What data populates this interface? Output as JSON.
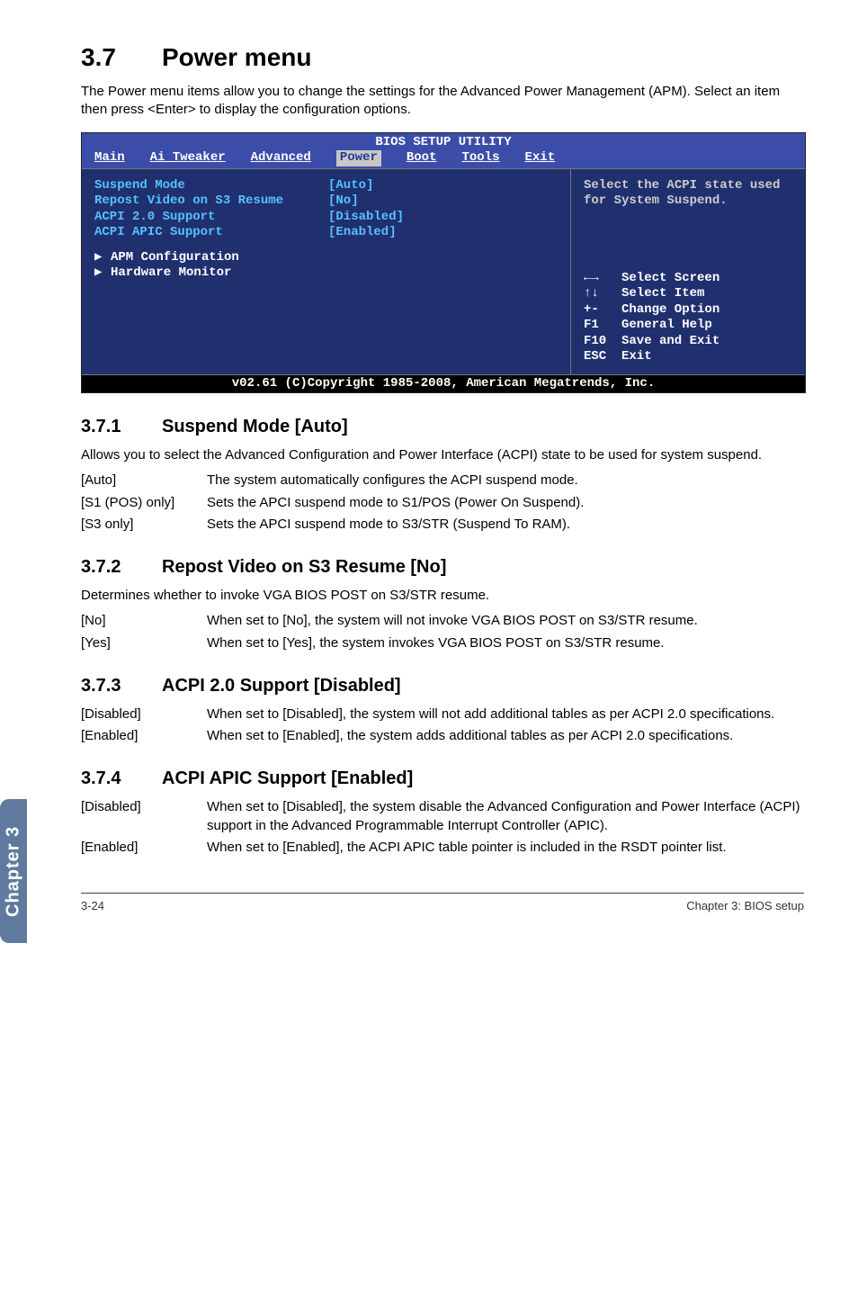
{
  "heading": {
    "num": "3.7",
    "title": "Power menu"
  },
  "intro": "The Power menu items allow you to change the settings for the Advanced Power Management (APM). Select an item then press <Enter> to display the configuration options.",
  "bios": {
    "title": "BIOS SETUP UTILITY",
    "menu": [
      "Main",
      "Ai Tweaker",
      "Advanced",
      "Power",
      "Boot",
      "Tools",
      "Exit"
    ],
    "selected_menu": "Power",
    "items": [
      {
        "label": "Suspend Mode",
        "value": "[Auto]"
      },
      {
        "label": "Repost Video on S3 Resume",
        "value": "[No]"
      },
      {
        "label": "ACPI 2.0 Support",
        "value": "[Disabled]"
      },
      {
        "label": "ACPI APIC Support",
        "value": "[Enabled]"
      }
    ],
    "subs": [
      "APM Configuration",
      "Hardware Monitor"
    ],
    "help": "Select the ACPI state used for System Suspend.",
    "keys": [
      {
        "k": "←→",
        "d": "Select Screen"
      },
      {
        "k": "↑↓",
        "d": "Select Item"
      },
      {
        "k": "+-",
        "d": "Change Option"
      },
      {
        "k": "F1",
        "d": "General Help"
      },
      {
        "k": "F10",
        "d": "Save and Exit"
      },
      {
        "k": "ESC",
        "d": "Exit"
      }
    ],
    "footer": "v02.61 (C)Copyright 1985-2008, American Megatrends, Inc."
  },
  "sections": [
    {
      "num": "3.7.1",
      "title": "Suspend Mode [Auto]",
      "para": "Allows you to select the Advanced Configuration and Power Interface (ACPI) state to be used for system suspend.",
      "opts": [
        {
          "k": "[Auto]",
          "v": "The system automatically configures the ACPI suspend mode."
        },
        {
          "k": "[S1 (POS) only]",
          "v": "Sets the APCI suspend mode to S1/POS (Power On Suspend)."
        },
        {
          "k": "[S3 only]",
          "v": "Sets the APCI suspend mode to S3/STR (Suspend To RAM)."
        }
      ]
    },
    {
      "num": "3.7.2",
      "title": "Repost Video on S3 Resume [No]",
      "para": "Determines whether to invoke VGA BIOS POST on S3/STR resume.",
      "opts": [
        {
          "k": "[No]",
          "v": "When set to [No], the system will not invoke VGA BIOS POST on S3/STR resume."
        },
        {
          "k": "[Yes]",
          "v": "When set to [Yes], the system invokes VGA BIOS POST on S3/STR resume."
        }
      ]
    },
    {
      "num": "3.7.3",
      "title": "ACPI 2.0 Support [Disabled]",
      "para": "",
      "opts": [
        {
          "k": "[Disabled]",
          "v": "When set to [Disabled], the system will not add additional tables as per ACPI 2.0 specifications."
        },
        {
          "k": "[Enabled]",
          "v": "When set to [Enabled], the system adds additional tables as per ACPI 2.0 specifications."
        }
      ]
    },
    {
      "num": "3.7.4",
      "title": "ACPI APIC Support [Enabled]",
      "para": "",
      "opts": [
        {
          "k": "[Disabled]",
          "v": "When set to [Disabled], the system disable the Advanced Configuration and Power Interface (ACPI) support in the Advanced Programmable Interrupt Controller (APIC)."
        },
        {
          "k": "[Enabled]",
          "v": "When set to [Enabled], the ACPI APIC table pointer is included in the RSDT pointer list."
        }
      ]
    }
  ],
  "side_tab": "Chapter 3",
  "footer": {
    "left": "3-24",
    "right": "Chapter 3: BIOS setup"
  }
}
